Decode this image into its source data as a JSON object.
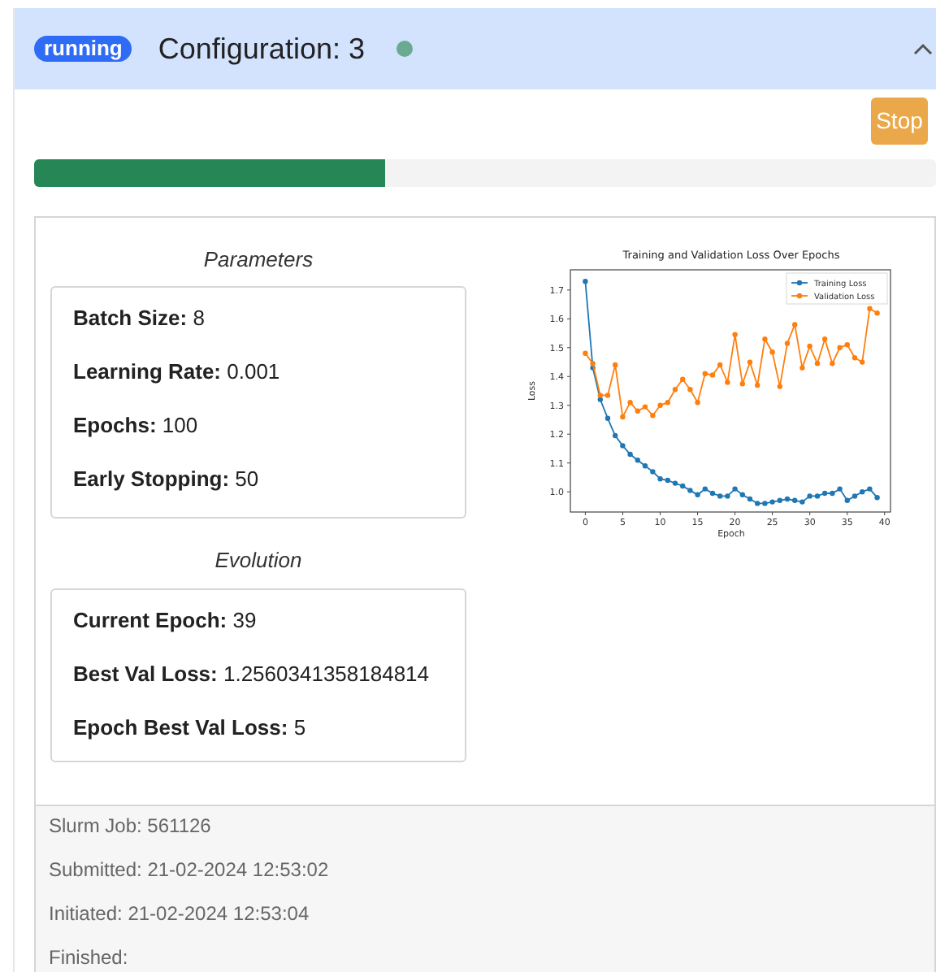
{
  "header": {
    "status_badge": "running",
    "title": "Configuration: 3",
    "expanded": true
  },
  "stop_button": "Stop",
  "progress": {
    "level": 0.39
  },
  "parameters": {
    "title": "Parameters",
    "items": [
      {
        "label": "Batch Size:",
        "value": "8"
      },
      {
        "label": "Learning Rate:",
        "value": "0.001"
      },
      {
        "label": "Epochs:",
        "value": "100"
      },
      {
        "label": "Early Stopping:",
        "value": "50"
      }
    ]
  },
  "evolution": {
    "title": "Evolution",
    "items": [
      {
        "label": "Current Epoch:",
        "value": "39"
      },
      {
        "label": "Best Val Loss:",
        "value": "1.2560341358184814"
      },
      {
        "label": "Epoch Best Val Loss:",
        "value": "5"
      }
    ]
  },
  "chart_data": {
    "type": "line",
    "title": "Training and Validation Loss Over Epochs",
    "xlabel": "Epoch",
    "ylabel": "Loss",
    "x": [
      0,
      1,
      2,
      3,
      4,
      5,
      6,
      7,
      8,
      9,
      10,
      11,
      12,
      13,
      14,
      15,
      16,
      17,
      18,
      19,
      20,
      21,
      22,
      23,
      24,
      25,
      26,
      27,
      28,
      29,
      30,
      31,
      32,
      33,
      34,
      35,
      36,
      37,
      38,
      39
    ],
    "series": [
      {
        "name": "Training Loss",
        "color": "#1f77b4",
        "marker": "o",
        "values": [
          1.73,
          1.43,
          1.32,
          1.255,
          1.195,
          1.16,
          1.13,
          1.11,
          1.09,
          1.07,
          1.045,
          1.04,
          1.03,
          1.02,
          1.005,
          0.99,
          1.01,
          0.995,
          0.985,
          0.985,
          1.01,
          0.99,
          0.975,
          0.96,
          0.96,
          0.965,
          0.97,
          0.975,
          0.97,
          0.965,
          0.985,
          0.985,
          0.995,
          0.995,
          1.01,
          0.97,
          0.985,
          1.0,
          1.01,
          0.98
        ]
      },
      {
        "name": "Validation Loss",
        "color": "#ff7f0e",
        "marker": "o",
        "values": [
          1.48,
          1.445,
          1.335,
          1.335,
          1.44,
          1.26,
          1.31,
          1.28,
          1.295,
          1.265,
          1.3,
          1.31,
          1.355,
          1.39,
          1.355,
          1.31,
          1.41,
          1.405,
          1.44,
          1.38,
          1.545,
          1.375,
          1.45,
          1.37,
          1.53,
          1.485,
          1.365,
          1.515,
          1.58,
          1.43,
          1.505,
          1.445,
          1.53,
          1.445,
          1.5,
          1.51,
          1.465,
          1.45,
          1.635,
          1.62
        ]
      }
    ],
    "xlim": [
      -2,
      41
    ],
    "ylim": [
      0.93,
      1.77
    ],
    "xticks": [
      0,
      5,
      10,
      15,
      20,
      25,
      30,
      35,
      40
    ],
    "yticks": [
      {
        "value": 1.0,
        "label": "1.0"
      },
      {
        "value": 1.1,
        "label": "1.1"
      },
      {
        "value": 1.2,
        "label": "1.2"
      },
      {
        "value": 1.3,
        "label": "1.3"
      },
      {
        "value": 1.4,
        "label": "1.4"
      },
      {
        "value": 1.5,
        "label": "1.5"
      },
      {
        "value": 1.6,
        "label": "1.6"
      },
      {
        "value": 1.7,
        "label": "1.7"
      }
    ],
    "legend": "upper right"
  },
  "footer": [
    "Slurm Job: 561126",
    "Submitted: 21-02-2024 12:53:02",
    "Initiated: 21-02-2024 12:53:04",
    "Finished:"
  ]
}
